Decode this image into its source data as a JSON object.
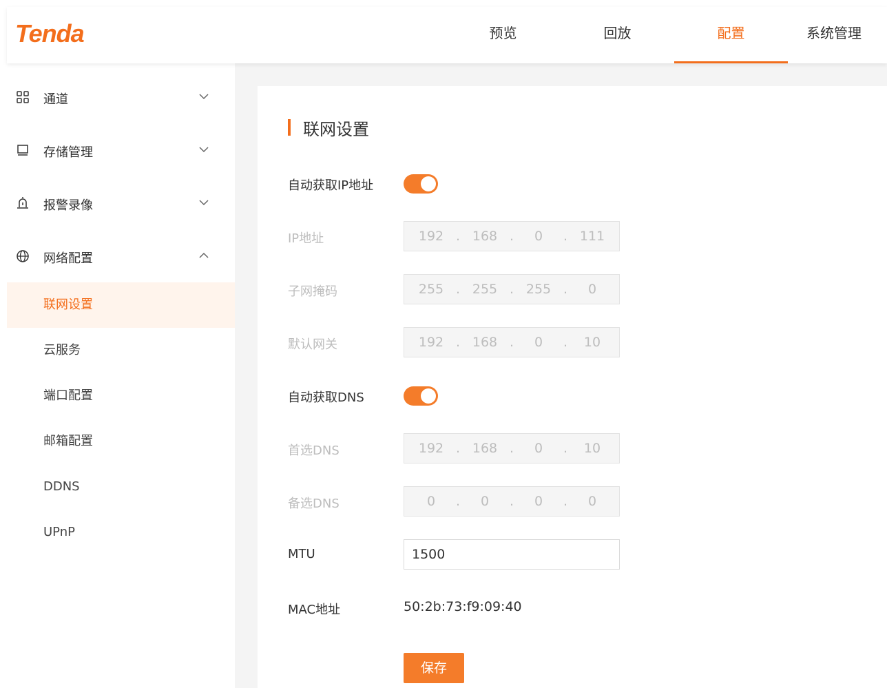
{
  "brand": {
    "logo_text": "Tenda",
    "accent": "#f36e1c"
  },
  "nav": {
    "tabs": [
      {
        "label": "预览"
      },
      {
        "label": "回放"
      },
      {
        "label": "配置",
        "active": true
      },
      {
        "label": "系统管理"
      }
    ]
  },
  "sidebar": {
    "groups": [
      {
        "label": "通道",
        "icon": "grid-icon",
        "expanded": false
      },
      {
        "label": "存储管理",
        "icon": "storage-icon",
        "expanded": false
      },
      {
        "label": "报警录像",
        "icon": "alarm-icon",
        "expanded": false
      },
      {
        "label": "网络配置",
        "icon": "globe-icon",
        "expanded": true
      }
    ],
    "items": [
      {
        "label": "联网设置",
        "active": true
      },
      {
        "label": "云服务"
      },
      {
        "label": "端口配置"
      },
      {
        "label": "邮箱配置"
      },
      {
        "label": "DDNS"
      },
      {
        "label": "UPnP"
      }
    ]
  },
  "form": {
    "title": "联网设置",
    "auto_ip": {
      "label": "自动获取IP地址",
      "on": true
    },
    "ip": {
      "label": "IP地址",
      "octets": [
        "192",
        "168",
        "0",
        "111"
      ]
    },
    "mask": {
      "label": "子网掩码",
      "octets": [
        "255",
        "255",
        "255",
        "0"
      ]
    },
    "gateway": {
      "label": "默认网关",
      "octets": [
        "192",
        "168",
        "0",
        "10"
      ]
    },
    "auto_dns": {
      "label": "自动获取DNS",
      "on": true
    },
    "dns1": {
      "label": "首选DNS",
      "octets": [
        "192",
        "168",
        "0",
        "10"
      ]
    },
    "dns2": {
      "label": "备选DNS",
      "octets": [
        "0",
        "0",
        "0",
        "0"
      ]
    },
    "mtu": {
      "label": "MTU",
      "value": "1500"
    },
    "mac": {
      "label": "MAC地址",
      "value": "50:2b:73:f9:09:40"
    },
    "save_label": "保存"
  },
  "ip_separator": "."
}
